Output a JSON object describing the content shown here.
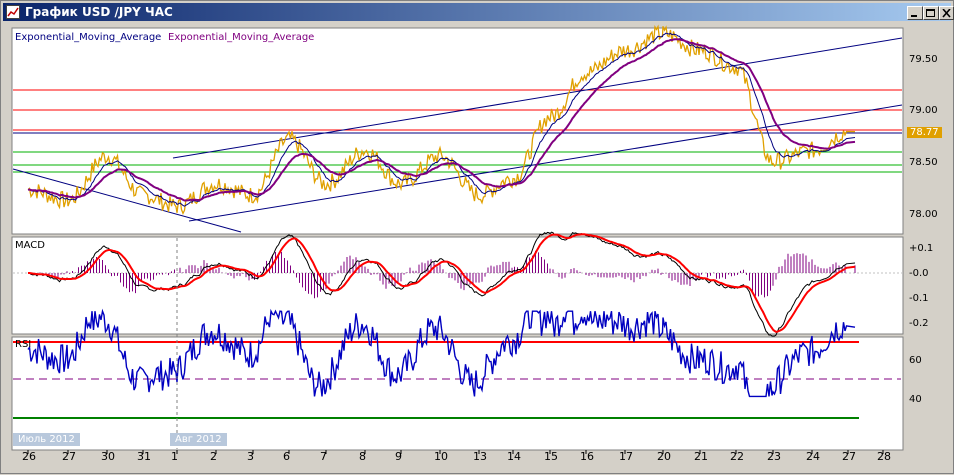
{
  "window": {
    "title": "График USD /JPY ЧАС"
  },
  "colors": {
    "price": "#e0a000",
    "ema_fast": "#000080",
    "ema_slow": "#800080",
    "macd_line": "#000000",
    "signal_line": "#ff0000",
    "histogram": "#800080",
    "rsi": "#0000c0",
    "rsi_upper": "#ff0000",
    "rsi_lower": "#008000",
    "hline_red": "#ff0000",
    "hline_green": "#00b000",
    "trend": "#000080",
    "last_price_bg": "#e0a000"
  },
  "price_panel": {
    "legend_1": "Exponential_Moving_Average",
    "legend_2": "Exponential_Moving_Average",
    "y_ticks": [
      "79.50",
      "79.00",
      "78.50",
      "78.00"
    ],
    "last_price": "78.77"
  },
  "macd_panel": {
    "label": "MACD",
    "y_ticks": [
      "+0.1",
      "-0.0",
      "-0.1",
      "-0.2"
    ]
  },
  "rsi_panel": {
    "label": "RSI",
    "y_ticks": [
      "60",
      "40"
    ]
  },
  "x_axis": {
    "month_1": "Июль 2012",
    "month_2": "Авг 2012",
    "days": [
      "26",
      "27",
      "30",
      "31",
      "1",
      "2",
      "3",
      "6",
      "7",
      "8",
      "9",
      "10",
      "13",
      "14",
      "15",
      "16",
      "17",
      "20",
      "21",
      "22",
      "23",
      "24",
      "27",
      "28"
    ]
  },
  "chart_data": {
    "type": "line",
    "title": "График USD /JPY ЧАС",
    "x": [
      "26",
      "27",
      "30",
      "31",
      "1",
      "2",
      "3",
      "6",
      "7",
      "8",
      "9",
      "10",
      "13",
      "14",
      "15",
      "16",
      "17",
      "20",
      "21",
      "22",
      "23",
      "24",
      "27"
    ],
    "series": [
      {
        "values": [
          78.25,
          78.15,
          78.55,
          78.2,
          78.1,
          78.3,
          78.2,
          78.7,
          78.3,
          78.6,
          78.3,
          78.55,
          78.2,
          78.35,
          78.9,
          79.3,
          79.5,
          79.65,
          79.5,
          79.35,
          78.5,
          78.6,
          78.77
        ]
      }
    ],
    "ylim": [
      77.85,
      79.7
    ],
    "y_ticks": [
      78.0,
      78.5,
      79.0,
      79.5
    ],
    "grid": false,
    "last_value": 78.77
  }
}
